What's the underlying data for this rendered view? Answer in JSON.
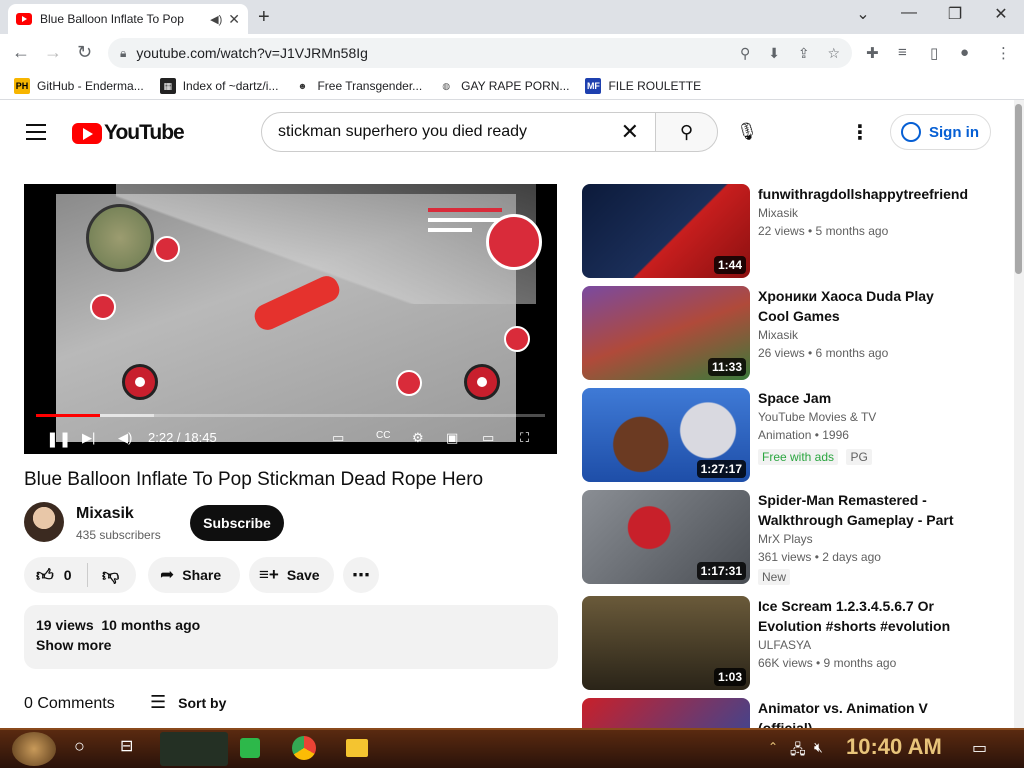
{
  "browser": {
    "tab_title": "Blue Balloon Inflate To Pop",
    "tab_audio_icon": "speaker-icon",
    "new_tab": "+",
    "window_controls": {
      "minimize": "—",
      "restore": "❐",
      "close": "✕",
      "dropdown": "⌄"
    },
    "url": "youtube.com/watch?v=J1VJRMn58Ig"
  },
  "bookmarks": [
    {
      "label": "GitHub - Enderma...",
      "icon_text": "PH",
      "icon_bg": "#f7b500",
      "icon_fg": "#000"
    },
    {
      "label": "Index of ~dartz/i...",
      "icon_text": "▦",
      "icon_bg": "#222",
      "icon_fg": "#fff"
    },
    {
      "label": "Free Transgender...",
      "icon_text": "☻",
      "icon_bg": "#fff",
      "icon_fg": "#333"
    },
    {
      "label": "GAY RAPE PORN...",
      "icon_text": "◍",
      "icon_bg": "#fff",
      "icon_fg": "#555"
    },
    {
      "label": "FILE ROULETTE",
      "icon_text": "MF",
      "icon_bg": "#1e40af",
      "icon_fg": "#fff"
    }
  ],
  "youtube": {
    "logo": "YouTube",
    "search_query": "stickman superhero you died ready",
    "sign_in": "Sign in"
  },
  "player": {
    "time": "2:22 / 18:45",
    "progress_fraction": 0.126
  },
  "video": {
    "title": "Blue Balloon Inflate To Pop Stickman Dead Rope Hero",
    "channel": "Mixasik",
    "subscribers": "435 subscribers",
    "subscribe_label": "Subscribe",
    "likes": "0",
    "share_label": "Share",
    "save_label": "Save",
    "views": "19 views",
    "age": "10 months ago",
    "show_more": "Show more",
    "comments": "0 Comments",
    "sort_by": "Sort by"
  },
  "recommendations": [
    {
      "title": "funwithragdollshappytreefriends",
      "channel": "Mixasik",
      "stats": "22 views • 5 months ago",
      "duration": "1:44",
      "thumb_color": "#1b2f5a"
    },
    {
      "title": "Хроники Хаоса Duda Play Cool Games",
      "channel": "Mixasik",
      "stats": "26 views • 6 months ago",
      "duration": "11:33",
      "thumb_color": "#5a3a7a"
    },
    {
      "title": "Space Jam",
      "channel": "YouTube Movies & TV",
      "stats": "Animation • 1996",
      "duration": "1:27:17",
      "thumb_color": "#2c5fb0",
      "badges": [
        "Free with ads",
        "PG"
      ]
    },
    {
      "title": "Spider-Man Remastered - Walkthrough Gameplay - Part ...",
      "channel": "MrX Plays",
      "stats": "361 views • 2 days ago",
      "duration": "1:17:31",
      "thumb_color": "#6a6e74",
      "badges": [
        "New"
      ]
    },
    {
      "title": "Ice Scream 1.2.3.4.5.6.7 Or Evolution #shorts #evolution",
      "channel": "ULFASYA",
      "stats": "66K views • 9 months ago",
      "duration": "1:03",
      "thumb_color": "#3a3426"
    },
    {
      "title": "Animator vs. Animation V (official)",
      "channel": "",
      "stats": "",
      "duration": "",
      "thumb_color": "#1e4ea8"
    }
  ],
  "taskbar": {
    "clock": "10:40 AM"
  }
}
